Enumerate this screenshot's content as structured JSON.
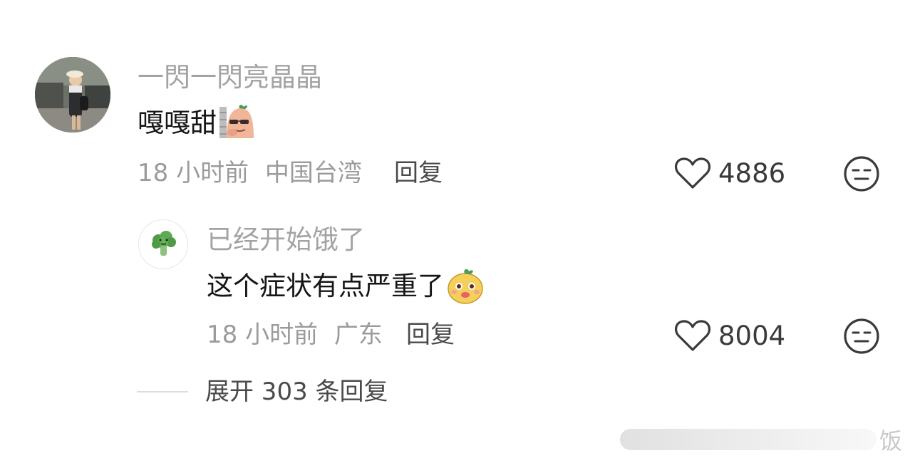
{
  "comment": {
    "username": "一閃一閃亮晶晶",
    "text": "嘎嘎甜",
    "time": "18 小时前",
    "location": "中国台湾",
    "reply_label": "回复",
    "likes": "4886",
    "emoji_name": "peeking-sweet-potato-emoji"
  },
  "reply": {
    "username": "已经开始饿了",
    "text": "这个症状有点严重了",
    "time": "18 小时前",
    "location": "广东",
    "reply_label": "回复",
    "likes": "8004",
    "emoji_name": "happy-potato-emoji"
  },
  "expand_label": "展开 303 条回复",
  "watermark": {
    "text": "饭"
  },
  "colors": {
    "username": "#a3a3a3",
    "text": "#161616",
    "meta": "#9b9b9b",
    "action": "#4a4a4a"
  }
}
